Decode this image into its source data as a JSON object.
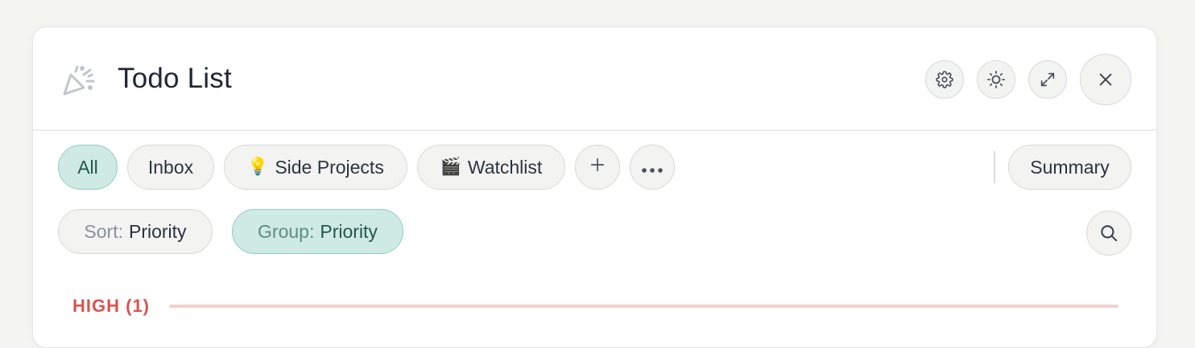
{
  "header": {
    "title": "Todo List",
    "icons": {
      "app": "party-popper-icon",
      "settings": "gear-icon",
      "theme": "sun-icon",
      "expand": "expand-arrows-icon",
      "close": "close-icon"
    }
  },
  "tabs": [
    {
      "label": "All",
      "emoji": "",
      "active": true
    },
    {
      "label": "Inbox",
      "emoji": "",
      "active": false
    },
    {
      "label": "Side Projects",
      "emoji": "💡",
      "active": false
    },
    {
      "label": "Watchlist",
      "emoji": "🎬",
      "active": false
    }
  ],
  "toolbar": {
    "add_icon": "plus-icon",
    "more_icon": "ellipsis-icon",
    "summary_label": "Summary"
  },
  "filters": {
    "sort_prefix": "Sort:",
    "sort_value": "Priority",
    "group_prefix": "Group:",
    "group_value": "Priority",
    "search_icon": "search-icon"
  },
  "sections": [
    {
      "label": "HIGH (1)",
      "color": "#d9534f"
    }
  ],
  "colors": {
    "accent_bg": "#cfe9e4",
    "accent_border": "#8fd0c2",
    "accent_text": "#22574b",
    "high_priority": "#d9534f"
  }
}
